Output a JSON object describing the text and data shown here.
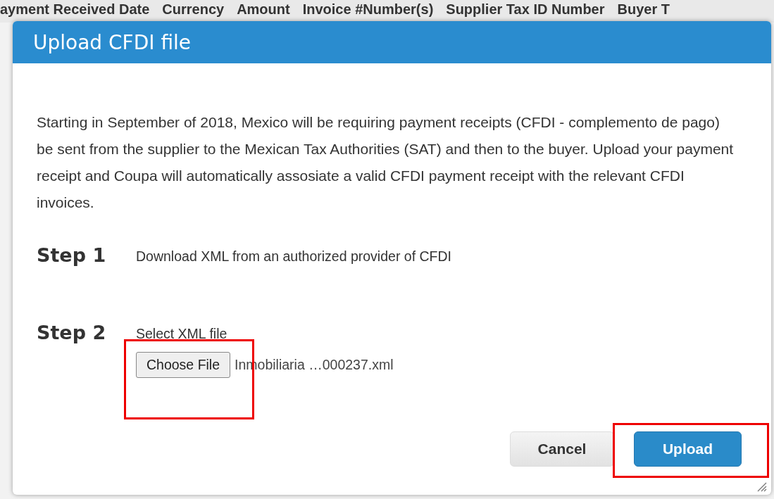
{
  "background_table": {
    "columns": [
      "ayment Received Date",
      "Currency",
      "Amount",
      "Invoice #Number(s)",
      "Supplier Tax ID Number",
      "Buyer T"
    ]
  },
  "dialog": {
    "title": "Upload CFDI file",
    "description": "Starting in September of 2018, Mexico will be requiring payment receipts (CFDI - complemento de pago) be sent from the supplier to the Mexican Tax Authorities (SAT) and then to the buyer. Upload your payment receipt and Coupa will automatically assosiate a valid CFDI payment receipt with the relevant CFDI invoices.",
    "steps": [
      {
        "kind": "text",
        "label": "Step 1",
        "text": "Download XML from an authorized provider of CFDI"
      },
      {
        "kind": "file",
        "label": "Step 2",
        "text": "Select XML file",
        "button": "Choose File",
        "file_name": "Inmobiliaria …000237.xml"
      }
    ],
    "buttons": [
      {
        "kind": "secondary",
        "label": "Cancel"
      },
      {
        "kind": "primary",
        "label": "Upload"
      }
    ]
  }
}
